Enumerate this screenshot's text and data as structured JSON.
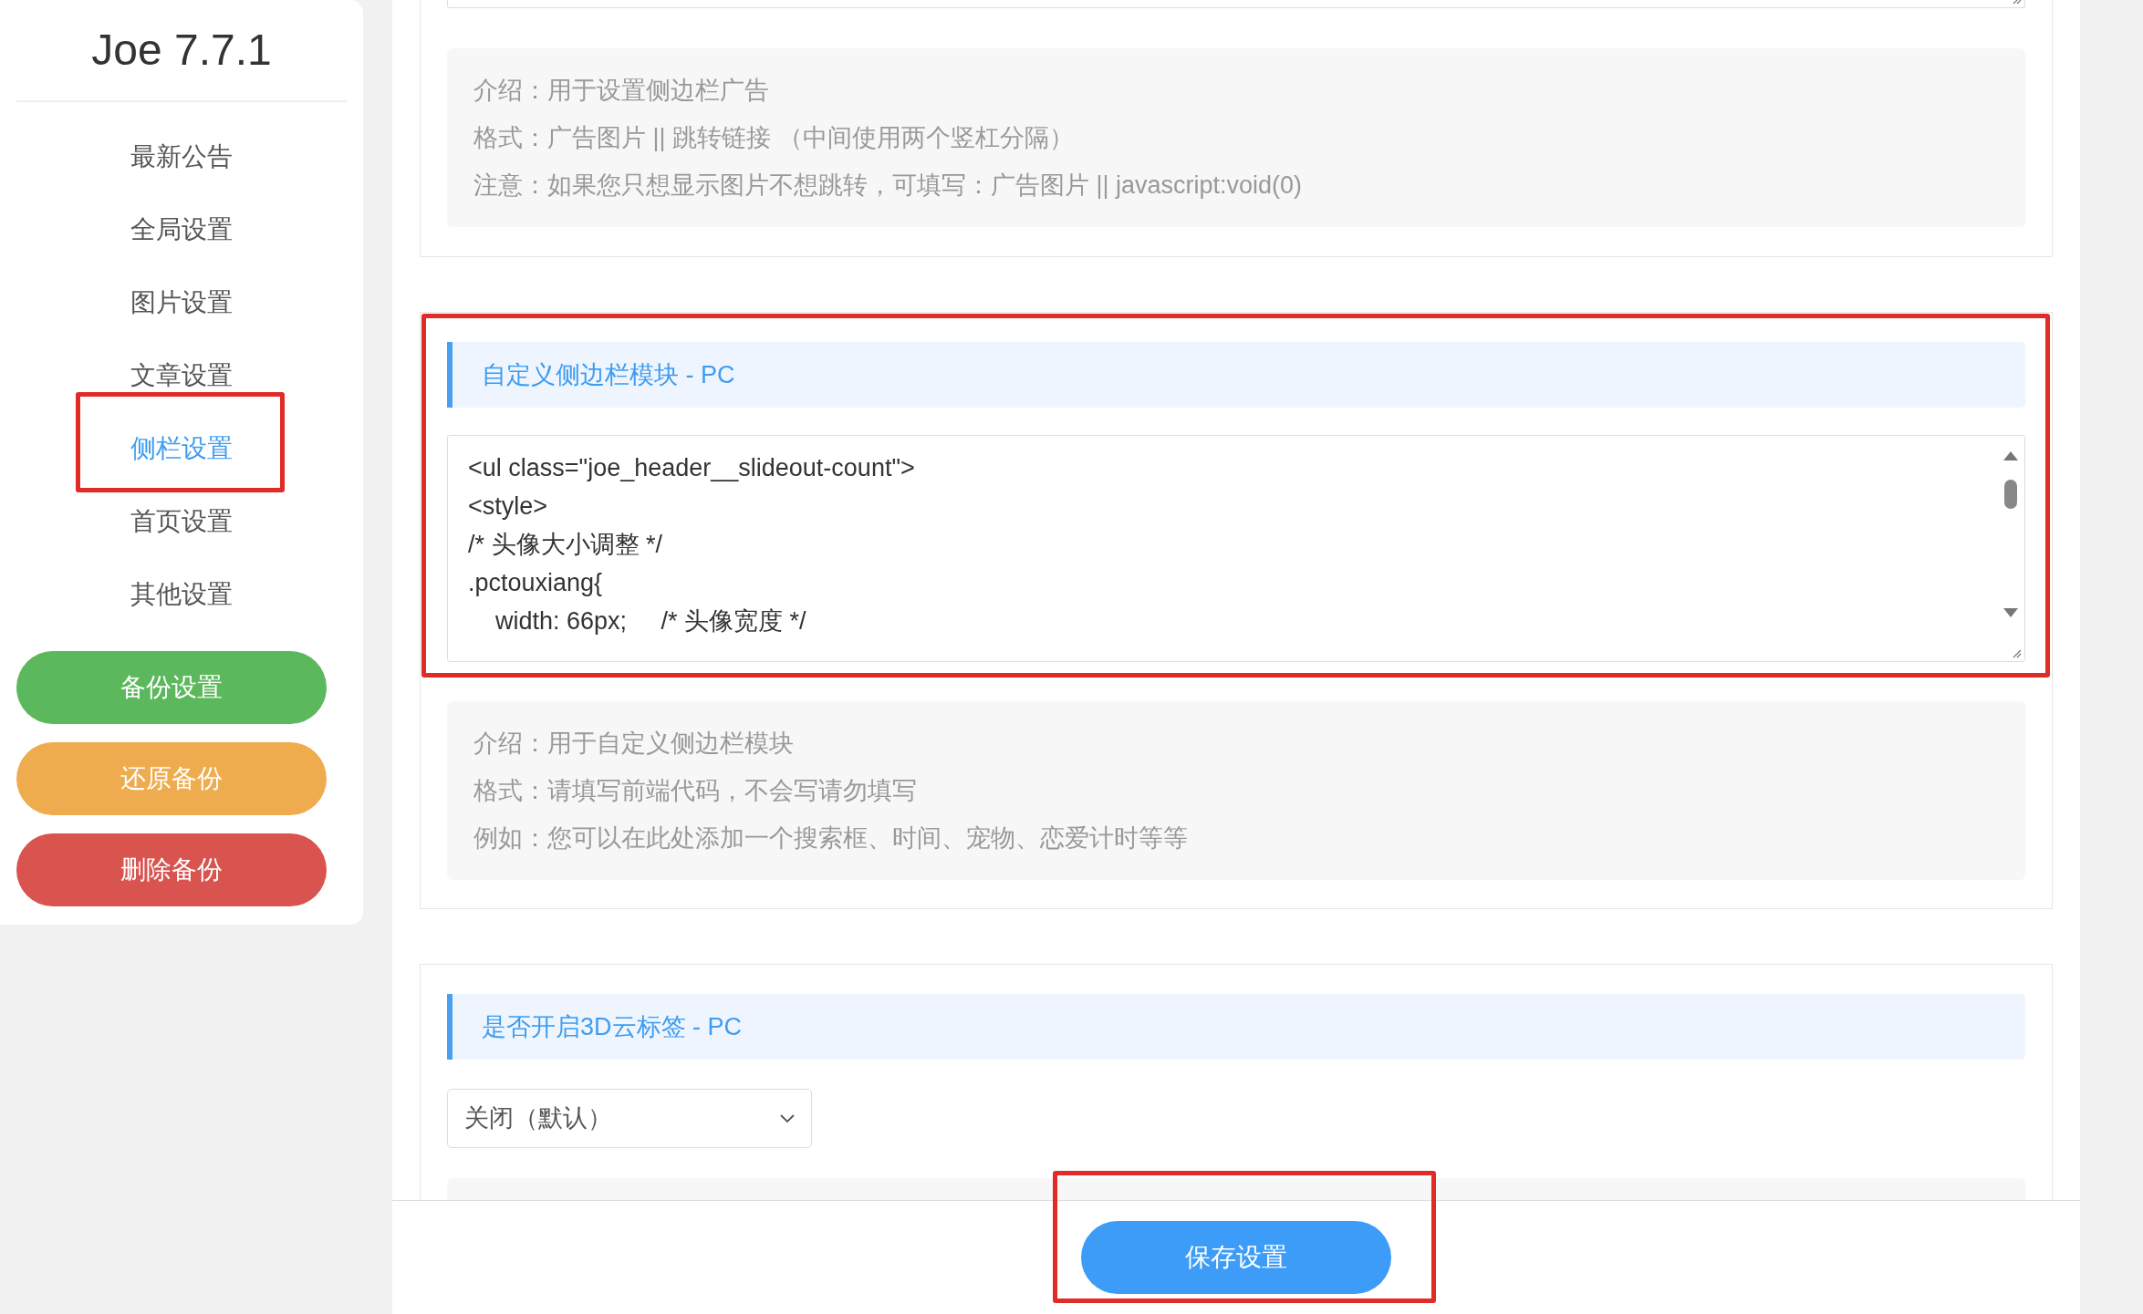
{
  "sidebar": {
    "title": "Joe 7.7.1",
    "items": [
      {
        "label": "最新公告",
        "selected": false,
        "highlighted": false
      },
      {
        "label": "全局设置",
        "selected": false,
        "highlighted": false
      },
      {
        "label": "图片设置",
        "selected": false,
        "highlighted": false
      },
      {
        "label": "文章设置",
        "selected": false,
        "highlighted": false
      },
      {
        "label": "侧栏设置",
        "selected": true,
        "highlighted": true
      },
      {
        "label": "首页设置",
        "selected": false,
        "highlighted": false
      },
      {
        "label": "其他设置",
        "selected": false,
        "highlighted": false
      }
    ],
    "buttons": [
      {
        "label": "备份设置",
        "color": "#5cb85c"
      },
      {
        "label": "还原备份",
        "color": "#efac4e"
      },
      {
        "label": "删除备份",
        "color": "#d9534f"
      }
    ]
  },
  "sections": [
    {
      "kind": "textarea-tail",
      "intro": [
        "介绍：用于设置侧边栏广告",
        "格式：广告图片 || 跳转链接 （中间使用两个竖杠分隔）",
        "注意：如果您只想显示图片不想跳转，可填写：广告图片 || javascript:void(0)"
      ]
    },
    {
      "kind": "code",
      "title": "自定义侧边栏模块 - PC",
      "highlighted": true,
      "code": [
        "<ul class=\"joe_header__slideout-count\">",
        "<style>",
        "/* 头像大小调整 */",
        ".pctouxiang{",
        "    width: 66px;     /* 头像宽度 */"
      ],
      "intro": [
        "介绍：用于自定义侧边栏模块",
        "格式：请填写前端代码，不会写请勿填写",
        "例如：您可以在此处添加一个搜索框、时间、宠物、恋爱计时等等"
      ]
    },
    {
      "kind": "select",
      "title": "是否开启3D云标签 - PC",
      "highlighted": false,
      "value": "关闭（默认）"
    }
  ],
  "save_button": {
    "label": "保存设置",
    "highlighted": true
  }
}
